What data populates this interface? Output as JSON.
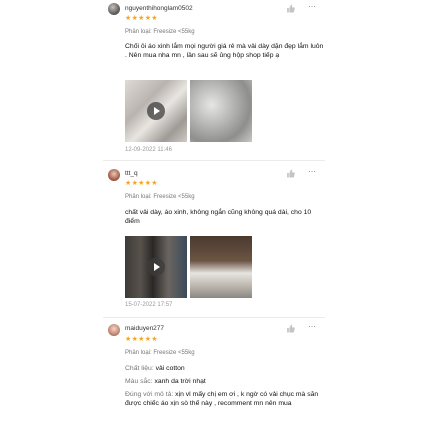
{
  "reviews": [
    {
      "username": "nguyenthihonglam0502",
      "rating": 5,
      "stars": "★★★★★",
      "variation": "Phân loại: Freesize <55kg",
      "text": "Chối ôi áo xinh lắm mọi người giá rẻ mà vải dày dặn đẹp lắm luôn . Nên mua nha mn , lần sau sẽ ủng hộp shop tiếp ạ",
      "date": "12-09-2022 11:46",
      "media": [
        "video-thumbnail",
        "image-thumbnail"
      ]
    },
    {
      "username": "ttt_q",
      "rating": 5,
      "stars": "★★★★★",
      "variation": "Phân loại: Freesize <55kg",
      "text": "chất vải dày, áo xinh, không ngắn cũng không quá dài, cho 10 điểm",
      "date": "15-07-2022 17:57",
      "media": [
        "video-thumbnail",
        "image-thumbnail"
      ]
    },
    {
      "username": "maiduyen277",
      "rating": 5,
      "stars": "★★★★★",
      "variation": "Phân loại: Freesize <55kg",
      "attributes": [
        {
          "label": "Chất liệu:",
          "value": "vải cotton"
        },
        {
          "label": "Màu sắc:",
          "value": "xanh da trời nhạt"
        },
        {
          "label": "Đúng với mô tả:",
          "value": "xịn vl mấy chị em ơi , k ngờ có vải chục mà săn được chiếc áo xịn sò thế này , recomment mn nên mua"
        }
      ]
    }
  ],
  "icons": {
    "like": "thumbs-up-icon",
    "more": "more-options-icon",
    "play": "play-icon"
  },
  "colors": {
    "star": "#f5a623",
    "muted_text": "#777777",
    "date_text": "#999999"
  }
}
